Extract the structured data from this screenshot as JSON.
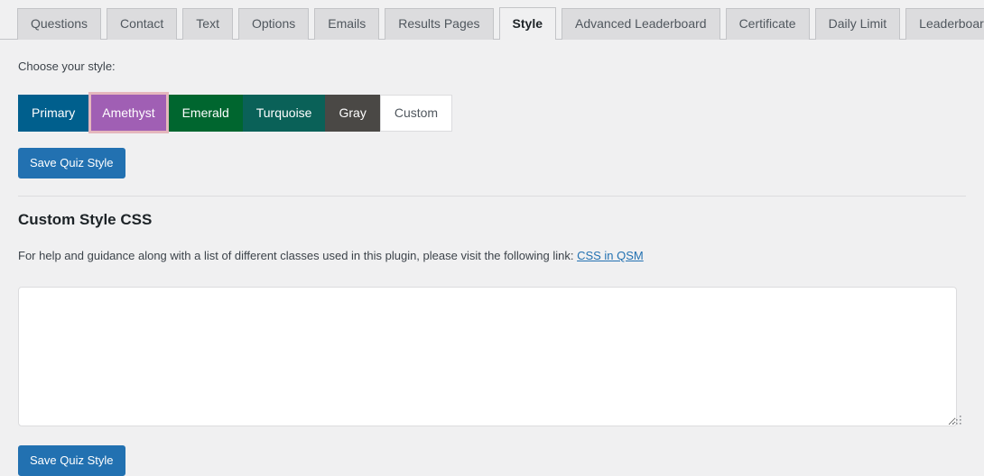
{
  "tabs": [
    {
      "label": "Questions",
      "active": false
    },
    {
      "label": "Contact",
      "active": false
    },
    {
      "label": "Text",
      "active": false
    },
    {
      "label": "Options",
      "active": false
    },
    {
      "label": "Emails",
      "active": false
    },
    {
      "label": "Results Pages",
      "active": false
    },
    {
      "label": "Style",
      "active": true
    },
    {
      "label": "Advanced Leaderboard",
      "active": false
    },
    {
      "label": "Certificate",
      "active": false
    },
    {
      "label": "Daily Limit",
      "active": false
    },
    {
      "label": "Leaderboards",
      "active": false
    }
  ],
  "style_section": {
    "choose_label": "Choose your style:",
    "options": [
      {
        "label": "Primary",
        "color": "#005f8d",
        "text_color": "#ffffff",
        "selected": false
      },
      {
        "label": "Amethyst",
        "color": "#a css",
        "selected": false
      }
    ],
    "styles": [
      {
        "label": "Primary",
        "bg": "#005f8d",
        "fg": "#ffffff",
        "selected": false
      },
      {
        "label": "Amethyst",
        "bg": "#a05fb4",
        "fg": "#ffffff",
        "selected": true,
        "selected_border": "#e5b7bd"
      },
      {
        "label": "Emerald",
        "bg": "#00662f",
        "fg": "#ffffff",
        "selected": false
      },
      {
        "label": "Turquoise",
        "bg": "#0a6158",
        "fg": "#ffffff",
        "selected": false
      },
      {
        "label": "Gray",
        "bg": "#4a4845",
        "fg": "#ffffff",
        "selected": false
      },
      {
        "label": "Custom",
        "bg": "#ffffff",
        "fg": "#50575e",
        "selected": false
      }
    ],
    "save_label": "Save Quiz Style"
  },
  "custom_css_section": {
    "title": "Custom Style CSS",
    "help_text_prefix": "For help and guidance along with a list of different classes used in this plugin, please visit the following link: ",
    "help_link_text": "CSS in QSM",
    "textarea_value": "",
    "textarea_placeholder": "",
    "save_label": "Save Quiz Style"
  },
  "colors": {
    "page_background": "#f0f0f1",
    "accent": "#2271b1",
    "tab_inactive_bg": "#dcdcde",
    "tab_border": "#c3c4c7",
    "link": "#2271b1"
  }
}
